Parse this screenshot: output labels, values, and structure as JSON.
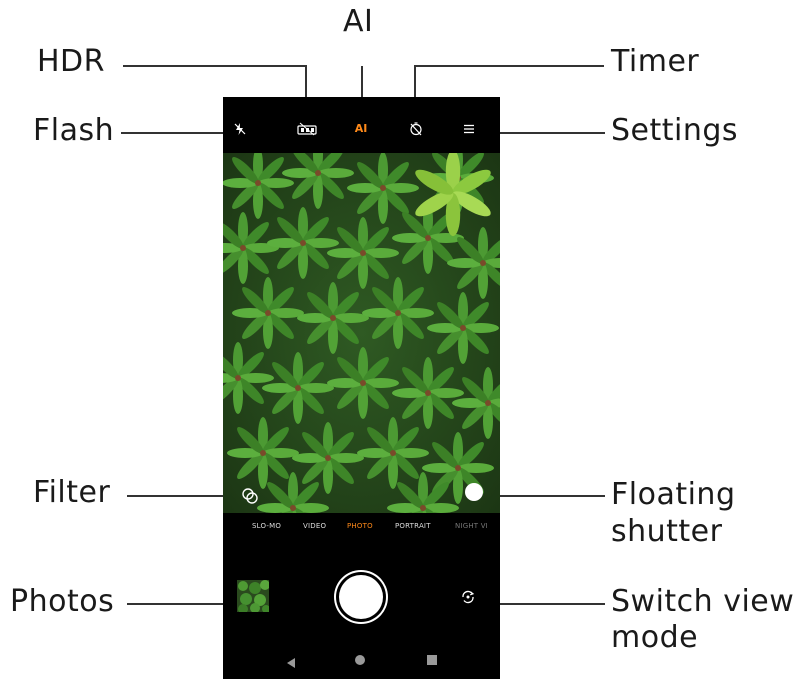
{
  "callouts": {
    "ai": "AI",
    "hdr": "HDR",
    "timer": "Timer",
    "flash": "Flash",
    "settings": "Settings",
    "filter": "Filter",
    "floating_shutter_line1": "Floating",
    "floating_shutter_line2": "shutter",
    "photos": "Photos",
    "switch_view_line1": "Switch view",
    "switch_view_line2": "mode"
  },
  "topbar": {
    "ai_label": "AI",
    "icons": [
      "flash-off-icon",
      "hdr-icon",
      "ai-icon",
      "timer-off-icon",
      "menu-icon"
    ]
  },
  "modes": {
    "items": [
      "SLO-MO",
      "VIDEO",
      "PHOTO",
      "PORTRAIT",
      "NIGHT VI"
    ],
    "active": "PHOTO"
  },
  "colors": {
    "accent": "#ff8a1a",
    "phone_bg": "#000000",
    "callout_line": "#333333"
  }
}
